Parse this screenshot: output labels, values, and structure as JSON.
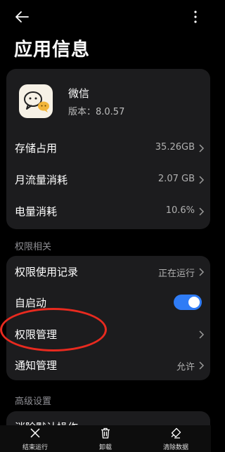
{
  "header": {
    "back_icon": "arrow-left-icon",
    "more_icon": "more-vertical-icon",
    "title": "应用信息"
  },
  "app": {
    "name": "微信",
    "version": "版本：8.0.57",
    "icon": "wechat-icon"
  },
  "info_rows": [
    {
      "label": "存储占用",
      "value": "35.26GB"
    },
    {
      "label": "月流量消耗",
      "value": "2.07 GB"
    },
    {
      "label": "电量消耗",
      "value": "10.6%"
    }
  ],
  "permissions_section": {
    "label": "权限相关",
    "rows": [
      {
        "label": "权限使用记录",
        "value": "正在运行"
      },
      {
        "label": "自启动",
        "toggle": true
      },
      {
        "label": "权限管理",
        "value": ""
      },
      {
        "label": "通知管理",
        "value": "允许"
      }
    ]
  },
  "advanced_section": {
    "label": "高级设置",
    "rows": [
      {
        "label": "消除默认操作"
      }
    ]
  },
  "bottom_bar": [
    {
      "label": "结束运行",
      "icon": "close-icon"
    },
    {
      "label": "卸载",
      "icon": "trash-icon"
    },
    {
      "label": "清除数据",
      "icon": "eraser-icon"
    }
  ],
  "colors": {
    "background": "#000000",
    "card": "#1c1c1e",
    "toggle_on": "#2f7cf6",
    "highlight": "#e82a1f"
  }
}
